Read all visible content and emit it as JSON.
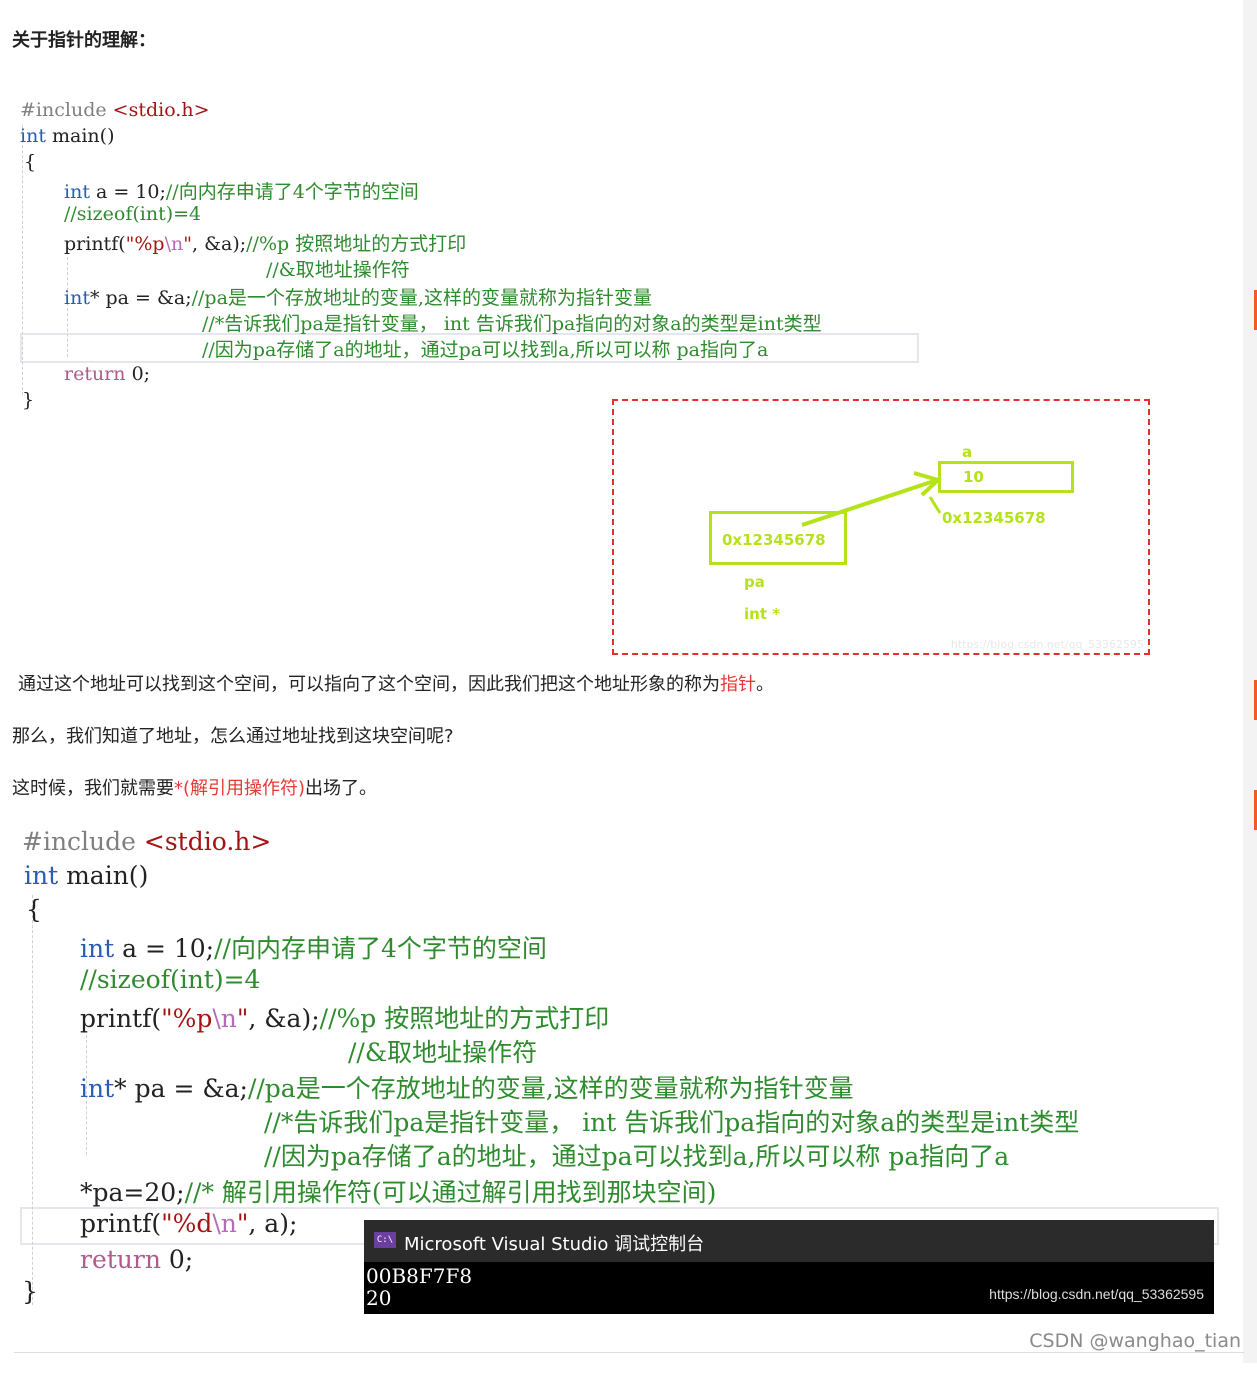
{
  "heading": "关于指针的理解：",
  "code1": {
    "include_kw": "#include",
    "include_file": "<stdio.h>",
    "main_type": "int",
    "main_rest": " main()",
    "open_brace": "{",
    "close_brace": "}",
    "line_a_kw": "int",
    "line_a_code": " a = 10;",
    "line_a_comment": "//向内存申请了4个字节的空间",
    "line_sizeof": "//sizeof(int)=4",
    "printf_name": "printf(",
    "printf_str1": "\"%p",
    "printf_esc": "\\n",
    "printf_str2": "\"",
    "printf_args": ", &a);",
    "printf_comment": "//%p 按照地址的方式打印",
    "addr_comment": "//&取地址操作符",
    "pa_kw": "int",
    "pa_code": "* pa = &a;",
    "pa_comment": "//pa是一个存放地址的变量,这样的变量就称为指针变量",
    "pa_comment2": "//*告诉我们pa是指针变量， int 告诉我们pa指向的对象a的类型是int类型",
    "pa_comment3": "//因为pa存储了a的地址，通过pa可以找到a,所以可以称 pa指向了a",
    "return_kw": "return",
    "return_val": " 0;"
  },
  "diagram": {
    "a_label": "a",
    "a_value": "10",
    "a_address": "0x12345678",
    "pa_value": "0x12345678",
    "pa_label": "pa",
    "pa_type": "int *",
    "watermark": "https://blog.csdn.net/qq_53362595"
  },
  "para1": {
    "before": "通过这个地址可以找到这个空间，可以指向了这个空间，因此我们把这个地址形象的称为",
    "highlight": "指针",
    "after": "。"
  },
  "para2": "那么，我们知道了地址，怎么通过地址找到这块空间呢?",
  "para3": {
    "before": "这时候，我们就需要",
    "highlight": "*(解引用操作符)",
    "after": "出场了。"
  },
  "code2": {
    "deref_line": "*pa=20;",
    "deref_comment": "//* 解引用操作符(可以通过解引用找到那块空间)",
    "printf2_str1": "\"%d",
    "printf2_args": ", a);"
  },
  "console": {
    "title": "Microsoft Visual Studio 调试控制台",
    "icon": "C:\\",
    "output_line1": "00B8F7F8",
    "output_line2": "20",
    "watermark": "https://blog.csdn.net/qq_53362595"
  },
  "footer_watermark": "CSDN @wanghao_tian",
  "colors": {
    "keyword": "#2a5db0",
    "comment": "#2e8b2e",
    "string": "#a31515",
    "diagram_green": "#b5e21a",
    "diagram_border": "#e23030",
    "highlight_red": "#e53935"
  }
}
